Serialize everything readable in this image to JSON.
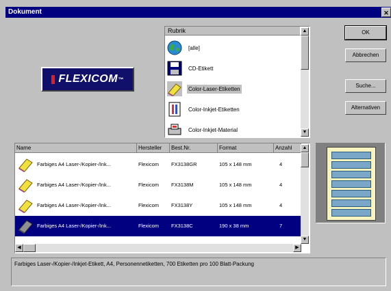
{
  "window": {
    "title": "Dokument"
  },
  "logo": {
    "text": "FLEXICOM"
  },
  "rubrik": {
    "header": "Rubrik",
    "items": [
      {
        "label": "[alle]",
        "icon": "globe-icon",
        "selected": false
      },
      {
        "label": "CD-Etikett",
        "icon": "floppy-icon",
        "selected": false
      },
      {
        "label": "Color-Laser-Etiketten",
        "icon": "label-roll-icon",
        "selected": true
      },
      {
        "label": "Color-Inkjet-Etiketten",
        "icon": "inkjet-icon",
        "selected": false
      },
      {
        "label": "Color-Inkjet-Material",
        "icon": "printer-icon",
        "selected": false
      }
    ]
  },
  "buttons": {
    "ok": "OK",
    "cancel": "Abbrechen",
    "search": "Suche...",
    "alternatives": "Alternativen"
  },
  "table": {
    "columns": [
      "Name",
      "Hersteller",
      "Best.Nr.",
      "Format",
      "Anzahl"
    ],
    "rows": [
      {
        "name": "Farbiges A4 Laser-/Kopier-/Ink...",
        "maker": "Flexicom",
        "order": "FX3138GR",
        "format": "105 x 148 mm",
        "count": "4",
        "selected": false
      },
      {
        "name": "Farbiges A4 Laser-/Kopier-/Ink...",
        "maker": "Flexicom",
        "order": "FX3138M",
        "format": "105 x 148 mm",
        "count": "4",
        "selected": false
      },
      {
        "name": "Farbiges A4 Laser-/Kopier-/Ink...",
        "maker": "Flexicom",
        "order": "FX3138Y",
        "format": "105 x 148 mm",
        "count": "4",
        "selected": false
      },
      {
        "name": "Farbiges A4 Laser-/Kopier-/Ink...",
        "maker": "Flexicom",
        "order": "FX3138C",
        "format": "190 x 38 mm",
        "count": "7",
        "selected": true
      }
    ]
  },
  "status": {
    "text": "Farbiges Laser-/Kopier-/Inkjet-Etikett, A4, Personennetiketten, 700 Etiketten pro 100 Blatt-Packung"
  },
  "colors": {
    "titlebar": "#000080",
    "face": "#c0c0c0",
    "selection": "#000080",
    "preview_label": "#7aa6c8"
  }
}
